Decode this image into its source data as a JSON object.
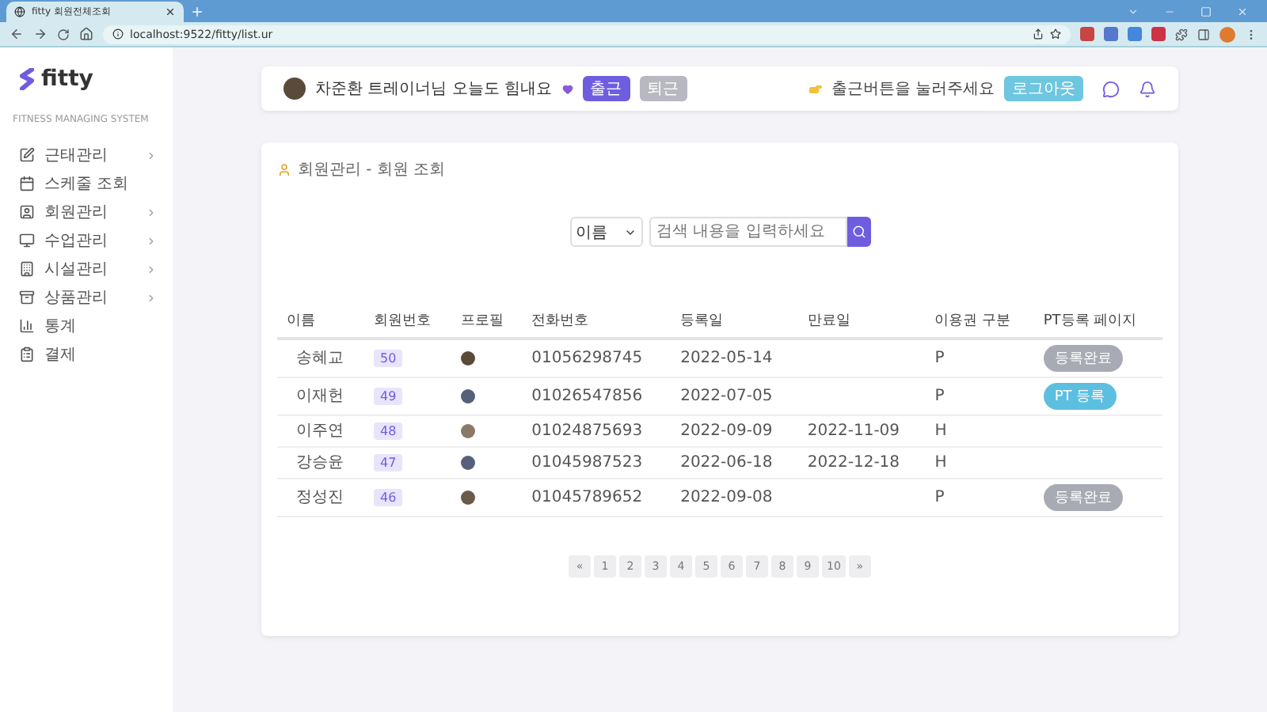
{
  "browser": {
    "tab_title": "fitty 회원전체조회",
    "url": "localhost:9522/fitty/list.ur"
  },
  "sidebar": {
    "logo": "fitty",
    "subtitle": "FITNESS MANAGING SYSTEM",
    "items": [
      {
        "label": "근태관리",
        "kind": "edit",
        "expandable": true
      },
      {
        "label": "스케줄 조회",
        "kind": "calendar",
        "expandable": false
      },
      {
        "label": "회원관리",
        "kind": "member",
        "expandable": true
      },
      {
        "label": "수업관리",
        "kind": "class",
        "expandable": true
      },
      {
        "label": "시설관리",
        "kind": "facility",
        "expandable": true
      },
      {
        "label": "상품관리",
        "kind": "product",
        "expandable": true
      },
      {
        "label": "통계",
        "kind": "chart",
        "expandable": false
      },
      {
        "label": "결제",
        "kind": "payment",
        "expandable": false
      }
    ]
  },
  "header": {
    "greeting": "차준환 트레이너님 오늘도 힘내요",
    "check_in": {
      "label": "출근",
      "disabled": false
    },
    "check_out": {
      "label": "퇴근",
      "disabled": true
    },
    "notice": "출근버튼을 눌러주세요",
    "logout": "로그아웃"
  },
  "page": {
    "title": "회원관리 - 회원 조회",
    "search": {
      "select": "이름",
      "placeholder": "검색 내용을 입력하세요"
    }
  },
  "table": {
    "columns": [
      "이름",
      "회원번호",
      "프로필",
      "전화번호",
      "등록일",
      "만료일",
      "이용권 구분",
      "PT등록 페이지"
    ],
    "rows": [
      {
        "name": "송혜교",
        "number": "50",
        "phone": "01056298745",
        "registered": "2022-05-14",
        "expires": "",
        "pass": "P",
        "pt": {
          "kind": "done",
          "label": "등록완료"
        }
      },
      {
        "name": "이재헌",
        "number": "49",
        "phone": "01026547856",
        "registered": "2022-07-05",
        "expires": "",
        "pass": "P",
        "pt": {
          "kind": "register",
          "label": "PT 등록"
        }
      },
      {
        "name": "이주연",
        "number": "48",
        "phone": "01024875693",
        "registered": "2022-09-09",
        "expires": "2022-11-09",
        "pass": "H",
        "pt": {
          "kind": "none"
        }
      },
      {
        "name": "강승윤",
        "number": "47",
        "phone": "01045987523",
        "registered": "2022-06-18",
        "expires": "2022-12-18",
        "pass": "H",
        "pt": {
          "kind": "none"
        }
      },
      {
        "name": "정성진",
        "number": "46",
        "phone": "01045789652",
        "registered": "2022-09-08",
        "expires": "",
        "pass": "P",
        "pt": {
          "kind": "done",
          "label": "등록완료"
        }
      }
    ]
  },
  "pagination": [
    "«",
    "1",
    "2",
    "3",
    "4",
    "5",
    "6",
    "7",
    "8",
    "9",
    "10",
    "»"
  ]
}
